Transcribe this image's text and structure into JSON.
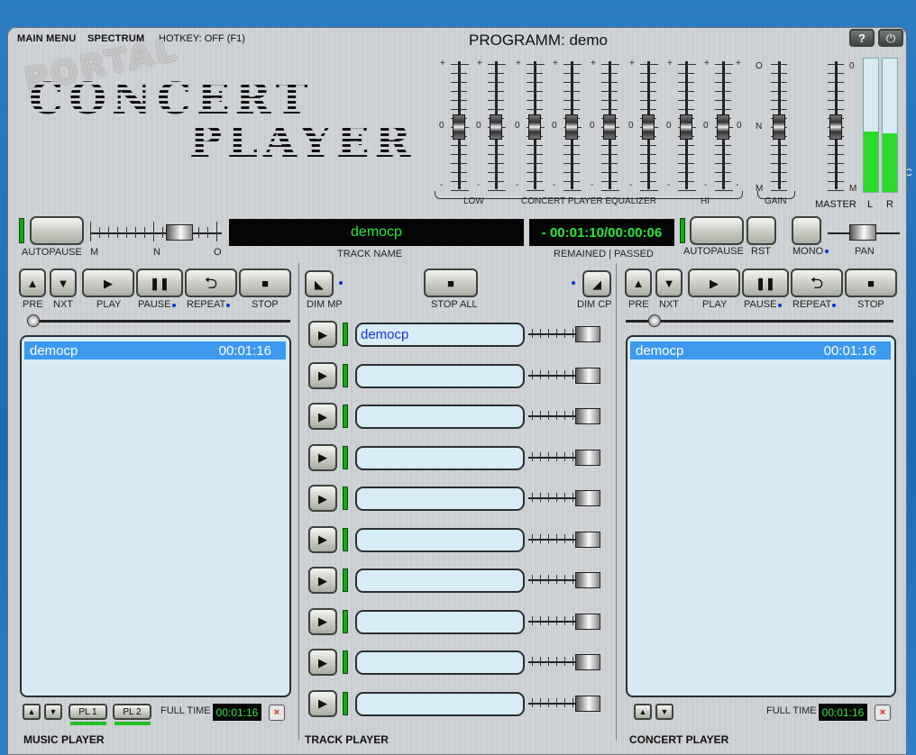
{
  "window": {
    "title": "PROGRAMM: demo"
  },
  "menu": {
    "main": "MAIN MENU",
    "spectrum": "SPECTRUM",
    "hotkey": "HOTKEY: OFF (F1)"
  },
  "watermark": "PORTAL",
  "logo": {
    "line1": "CONCERT",
    "line2": "PLAYER"
  },
  "equalizer": {
    "scale_plus": "+",
    "scale_zero": "0",
    "scale_minus": "-",
    "low": "LOW",
    "title": "CONCERT PLAYER EQUALIZER",
    "hi": "HI",
    "gain_label": "GAIN",
    "gain_o": "O",
    "gain_n": "N",
    "gain_m": "M",
    "master_label": "MASTER",
    "master_0": "0",
    "master_m": "M",
    "meter_l": "L",
    "meter_r": "R",
    "meter_l_level": 0.45,
    "meter_r_level": 0.44
  },
  "top_controls": {
    "left_autopause": "AUTOPAUSE",
    "m": "M",
    "n": "N",
    "o": "O",
    "track_name": "democp",
    "track_name_label": "TRACK NAME",
    "time": "- 00:01:10/00:00:06",
    "time_label": "REMAINED | PASSED",
    "right_autopause": "AUTOPAUSE",
    "rst": "RST",
    "mono": "MONO",
    "pan": "PAN"
  },
  "music_player": {
    "pre": "PRE",
    "nxt": "NXT",
    "play": "PLAY",
    "pause": "PAUSE",
    "repeat": "REPEAT",
    "stop": "STOP",
    "playlist": [
      {
        "name": "democp",
        "time": "00:01:16"
      }
    ],
    "pl1": "PL 1",
    "pl2": "PL 2",
    "full_time_label": "FULL TIME",
    "full_time": "00:01:16",
    "section": "MUSIC PLAYER"
  },
  "track_player": {
    "dim_mp": "DIM MP",
    "stop_all": "STOP ALL",
    "dim_cp": "DIM CP",
    "tracks": [
      "democp",
      "",
      "",
      "",
      "",
      "",
      "",
      "",
      "",
      ""
    ],
    "section": "TRACK PLAYER"
  },
  "concert_player": {
    "pre": "PRE",
    "nxt": "NXT",
    "play": "PLAY",
    "pause": "PAUSE",
    "repeat": "REPEAT",
    "stop": "STOP",
    "playlist": [
      {
        "name": "democp",
        "time": "00:01:16"
      }
    ],
    "full_time_label": "FULL TIME",
    "full_time": "00:01:16",
    "section": "CONCERT PLAYER"
  },
  "icons": {
    "help": "question-icon",
    "power": "power-icon",
    "up": "triangle-up-icon",
    "down": "triangle-down-icon",
    "play": "play-icon",
    "pause": "pause-icon",
    "repeat": "repeat-icon",
    "stop": "stop-icon",
    "close": "close-icon"
  },
  "colors": {
    "display_green": "#28e83c",
    "selection_blue": "#3d98f0",
    "led_green": "#12a912"
  }
}
